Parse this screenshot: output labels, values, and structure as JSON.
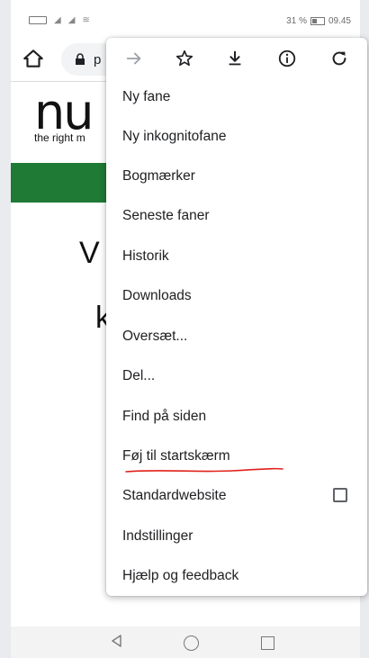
{
  "status_bar": {
    "battery": "31 %",
    "time": "09.45"
  },
  "address_bar": {
    "url_visible": "p"
  },
  "page": {
    "brand": "nu",
    "tagline": "the right m",
    "big_letter_1": "V",
    "big_letter_2": "k"
  },
  "menu": {
    "items": [
      {
        "label": "Ny fane"
      },
      {
        "label": "Ny inkognitofane"
      },
      {
        "label": "Bogmærker"
      },
      {
        "label": "Seneste faner"
      },
      {
        "label": "Historik"
      },
      {
        "label": "Downloads"
      },
      {
        "label": "Oversæt..."
      },
      {
        "label": "Del..."
      },
      {
        "label": "Find på siden"
      },
      {
        "label": "Føj til startskærm"
      },
      {
        "label": "Standardwebsite",
        "checkbox": false
      },
      {
        "label": "Indstillinger"
      },
      {
        "label": "Hjælp og feedback"
      }
    ]
  },
  "colors": {
    "green_band": "#1f7a35",
    "annotation_red": "#e0201a"
  }
}
